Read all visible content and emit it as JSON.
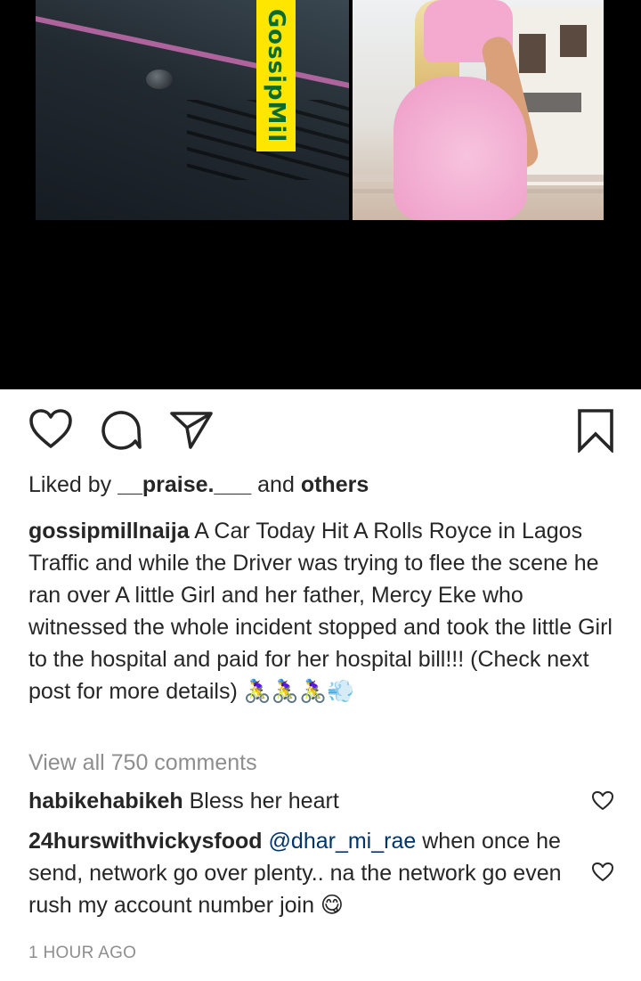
{
  "media": {
    "watermark": "GossipMil"
  },
  "actions": {
    "like_icon": "heart-icon",
    "comment_icon": "comment-icon",
    "share_icon": "share-icon",
    "save_icon": "bookmark-icon"
  },
  "likes": {
    "prefix": "Liked by",
    "user": "__praise.___",
    "conjunction": "and",
    "others": "others"
  },
  "caption": {
    "username": "gossipmillnaija",
    "text": "A Car Today Hit A Rolls Royce in Lagos Traffic and while the Driver was trying to flee the scene he ran over A little Girl and her father, Mercy Eke who witnessed the whole incident stopped and took the little Girl to the hospital and paid for her hospital bill!!! (Check next post for more details)",
    "emoji": "🚴‍♀️🚴‍♀️🚴‍♀️💨"
  },
  "view_all": "View all 750 comments",
  "comments": [
    {
      "username": "habikehabikeh",
      "mention": "",
      "text": "Bless her heart"
    },
    {
      "username": "24hurswithvickysfood",
      "mention": "@dhar_mi_rae",
      "text": "when once he send, network go over plenty.. na the network go even rush my account number join 😋"
    }
  ],
  "timestamp": "1 HOUR AGO",
  "colors": {
    "text": "#262626",
    "muted": "#8e8e8e",
    "mention": "#003569",
    "watermark_bg": "#ffe600",
    "watermark_text": "#0a6c2c"
  }
}
